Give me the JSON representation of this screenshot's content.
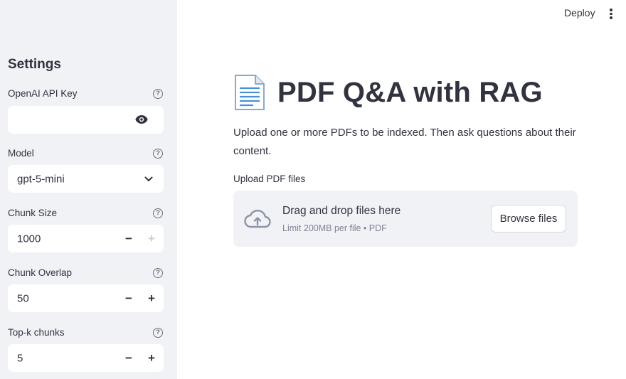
{
  "sidebar": {
    "title": "Settings",
    "api_key": {
      "label": "OpenAI API Key",
      "value": "",
      "help": "?"
    },
    "model": {
      "label": "Model",
      "value": "gpt-5-mini",
      "help": "?"
    },
    "chunk_size": {
      "label": "Chunk Size",
      "value": "1000",
      "minus": "−",
      "plus": "+",
      "help": "?"
    },
    "chunk_overlap": {
      "label": "Chunk Overlap",
      "value": "50",
      "minus": "−",
      "plus": "+",
      "help": "?"
    },
    "top_k": {
      "label": "Top-k chunks",
      "value": "5",
      "minus": "−",
      "plus": "+",
      "help": "?"
    }
  },
  "header": {
    "deploy_label": "Deploy"
  },
  "main": {
    "title": "PDF Q&A with RAG",
    "description": "Upload one or more PDFs to be indexed. Then ask questions about their content.",
    "uploader": {
      "label": "Upload PDF files",
      "drop_text": "Drag and drop files here",
      "limit_text": "Limit 200MB per file • PDF",
      "browse_label": "Browse files"
    }
  },
  "icons": {
    "help": "help-circle-icon",
    "eye": "eye-icon",
    "chevron": "chevron-down-icon",
    "document": "page-facing-up-icon",
    "cloud": "cloud-upload-icon",
    "kebab": "vertical-dots-icon"
  },
  "colors": {
    "sidebar_bg": "#f0f2f6",
    "text": "#31333f",
    "muted": "#808495",
    "cloud": "#8b93a8"
  }
}
